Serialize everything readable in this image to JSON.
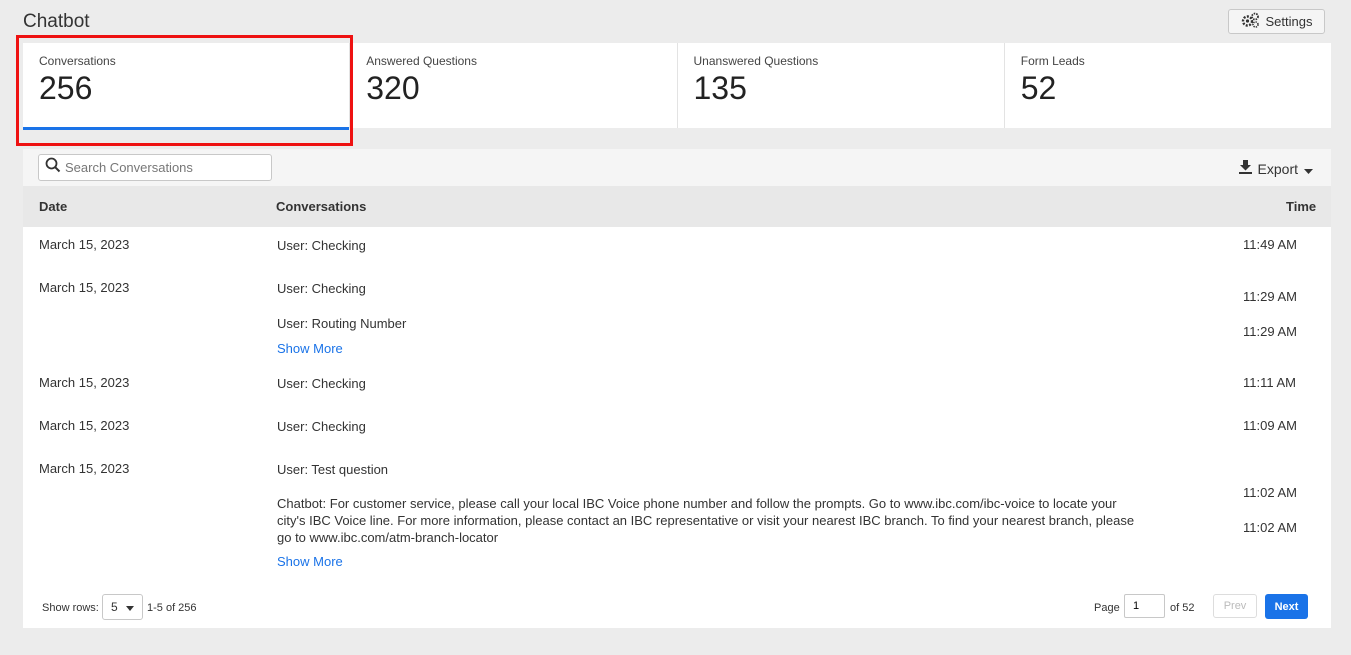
{
  "header": {
    "title": "Chatbot",
    "settings_label": "Settings"
  },
  "stats": [
    {
      "label": "Conversations",
      "value": "256"
    },
    {
      "label": "Answered Questions",
      "value": "320"
    },
    {
      "label": "Unanswered Questions",
      "value": "135"
    },
    {
      "label": "Form Leads",
      "value": "52"
    }
  ],
  "toolbar": {
    "search_placeholder": "Search Conversations",
    "export_label": "Export"
  },
  "table": {
    "columns": {
      "date": "Date",
      "conversations": "Conversations",
      "time": "Time"
    },
    "rows": [
      {
        "date": "March 15, 2023",
        "messages": [
          {
            "text": "User: Checking",
            "time": "11:49 AM"
          }
        ]
      },
      {
        "date": "March 15, 2023",
        "messages": [
          {
            "text": "User: Checking",
            "time": "11:29 AM"
          },
          {
            "text": "User: Routing Number",
            "time": "11:29 AM"
          }
        ],
        "show_more": "Show More"
      },
      {
        "date": "March 15, 2023",
        "messages": [
          {
            "text": "User: Checking",
            "time": "11:11 AM"
          }
        ]
      },
      {
        "date": "March 15, 2023",
        "messages": [
          {
            "text": "User: Checking",
            "time": "11:09 AM"
          }
        ]
      },
      {
        "date": "March 15, 2023",
        "messages": [
          {
            "text": "User: Test question",
            "time": "11:02 AM"
          },
          {
            "text": "Chatbot: For customer service, please call your local IBC Voice phone number and follow the prompts. Go to www.ibc.com/ibc-voice to locate your city's IBC Voice line. For more information, please contact an IBC representative or visit your nearest IBC branch. To find your nearest branch, please go to www.ibc.com/atm-branch-locator",
            "time": "11:02 AM"
          }
        ],
        "show_more": "Show More"
      }
    ]
  },
  "pagination": {
    "show_rows_label": "Show rows:",
    "rows_value": "5",
    "range_text": "1-5 of 256",
    "page_label": "Page",
    "page_value": "1",
    "of_label": "of 52",
    "prev_label": "Prev",
    "next_label": "Next"
  },
  "colors": {
    "accent": "#1a73e8",
    "highlight": "#ee1111"
  }
}
